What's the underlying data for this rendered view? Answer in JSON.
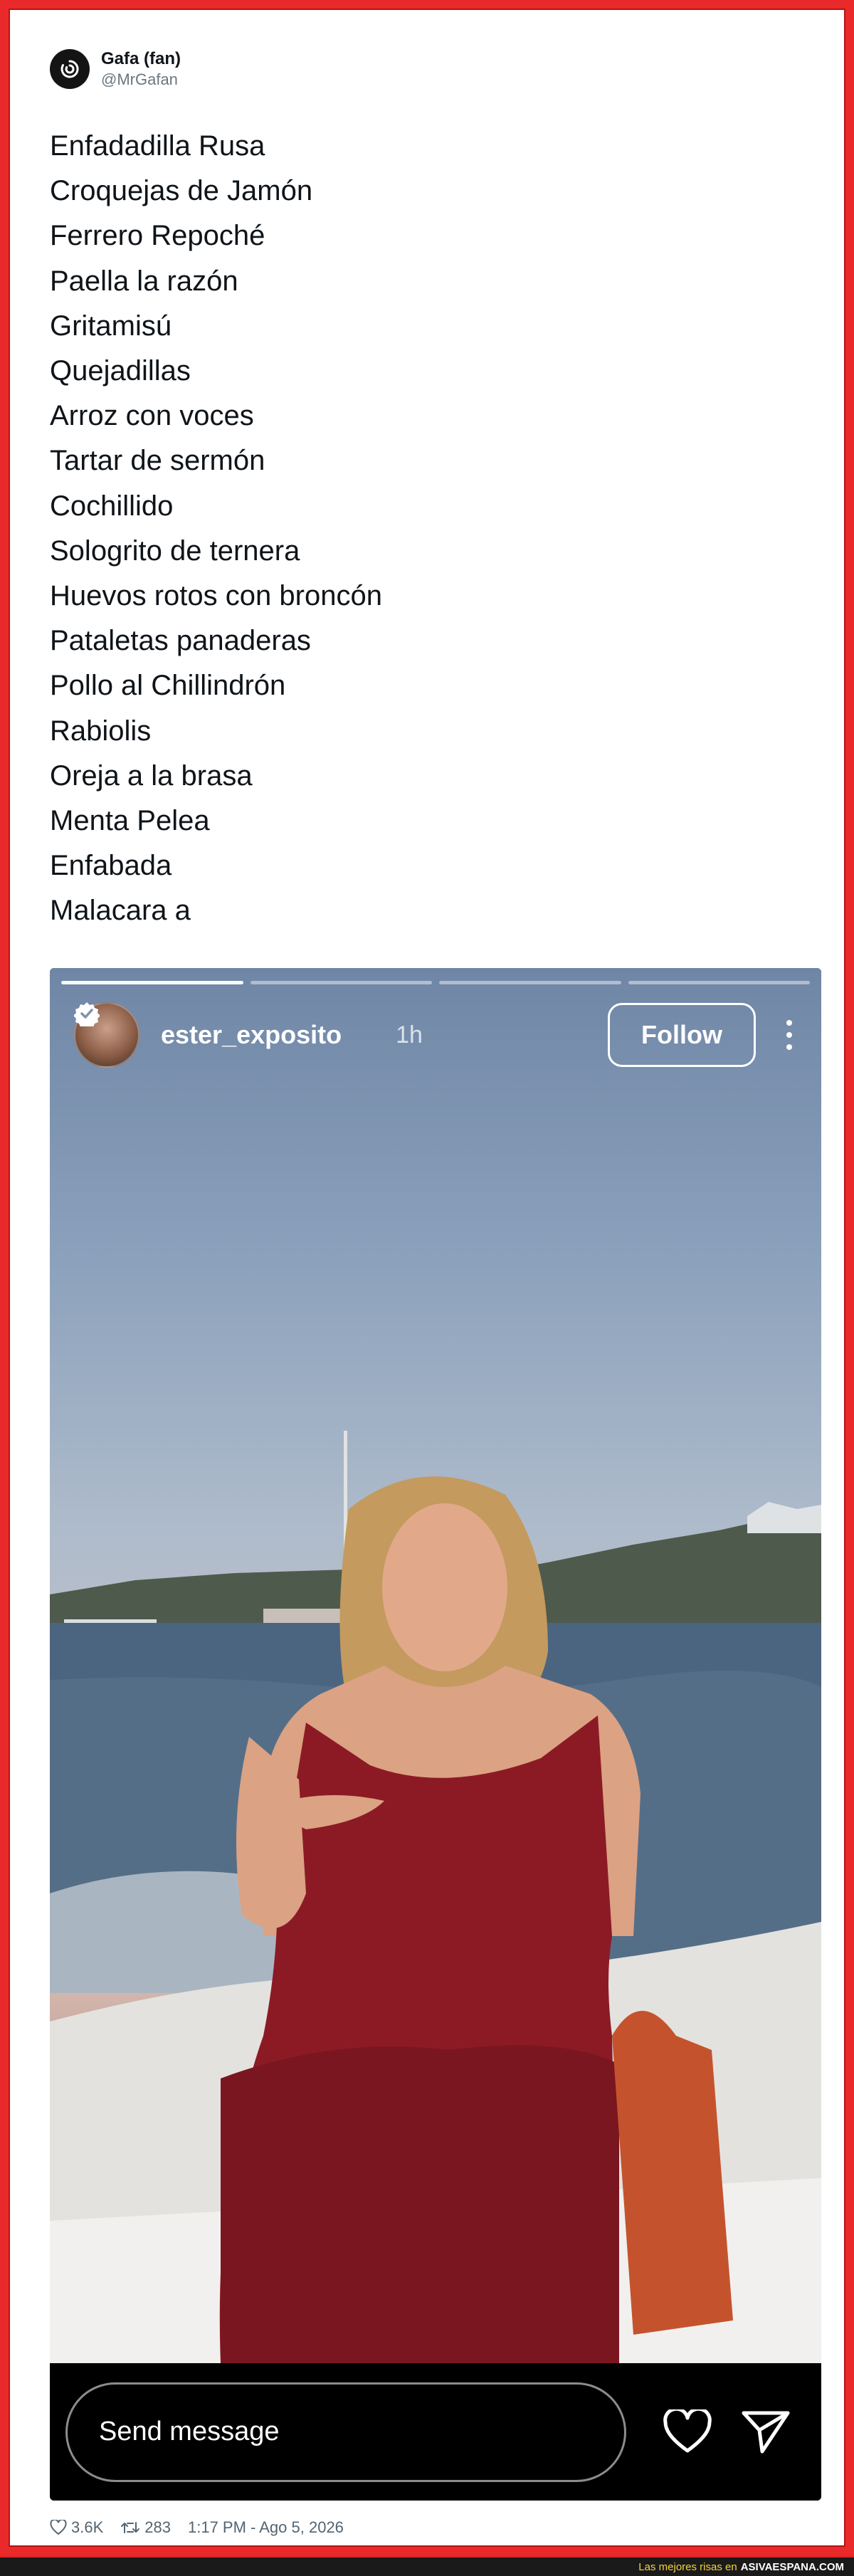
{
  "tweet": {
    "display_name": "Gafa (fan)",
    "handle": "@MrGafan",
    "avatar_icon": "spiral-logo-icon",
    "lines": [
      "Enfadadilla Rusa",
      "Croquejas de Jamón",
      "Ferrero Repoché",
      "Paella la razón",
      "Gritamisú",
      "Quejadillas",
      "Arroz con voces",
      "Tartar de sermón",
      "Cochillido",
      "Sologrito de ternera",
      "Huevos rotos con broncón",
      "Pataletas panaderas",
      "Pollo al Chillindrón",
      "Rabiolis",
      "Oreja a la brasa",
      "Menta Pelea",
      "Enfabada",
      "Malacara a"
    ],
    "likes": "3.6K",
    "retweets": "283",
    "timestamp": "1:17 PM - Ago 5, 2026"
  },
  "story": {
    "username": "ester_exposito",
    "time": "1h",
    "follow_label": "Follow",
    "send_placeholder": "Send message",
    "progress_segments": 4,
    "progress_done": 1,
    "verified_icon": "verified-badge-icon",
    "more_icon": "more-vertical-icon",
    "like_icon": "heart-icon",
    "send_icon": "send-icon"
  },
  "watermark": {
    "tagline": "Las mejores risas en",
    "site": "ASIVAESPANA.COM"
  },
  "colors": {
    "frame_red": "#ea2a2a",
    "bar_yellow": "#f6d33c"
  }
}
